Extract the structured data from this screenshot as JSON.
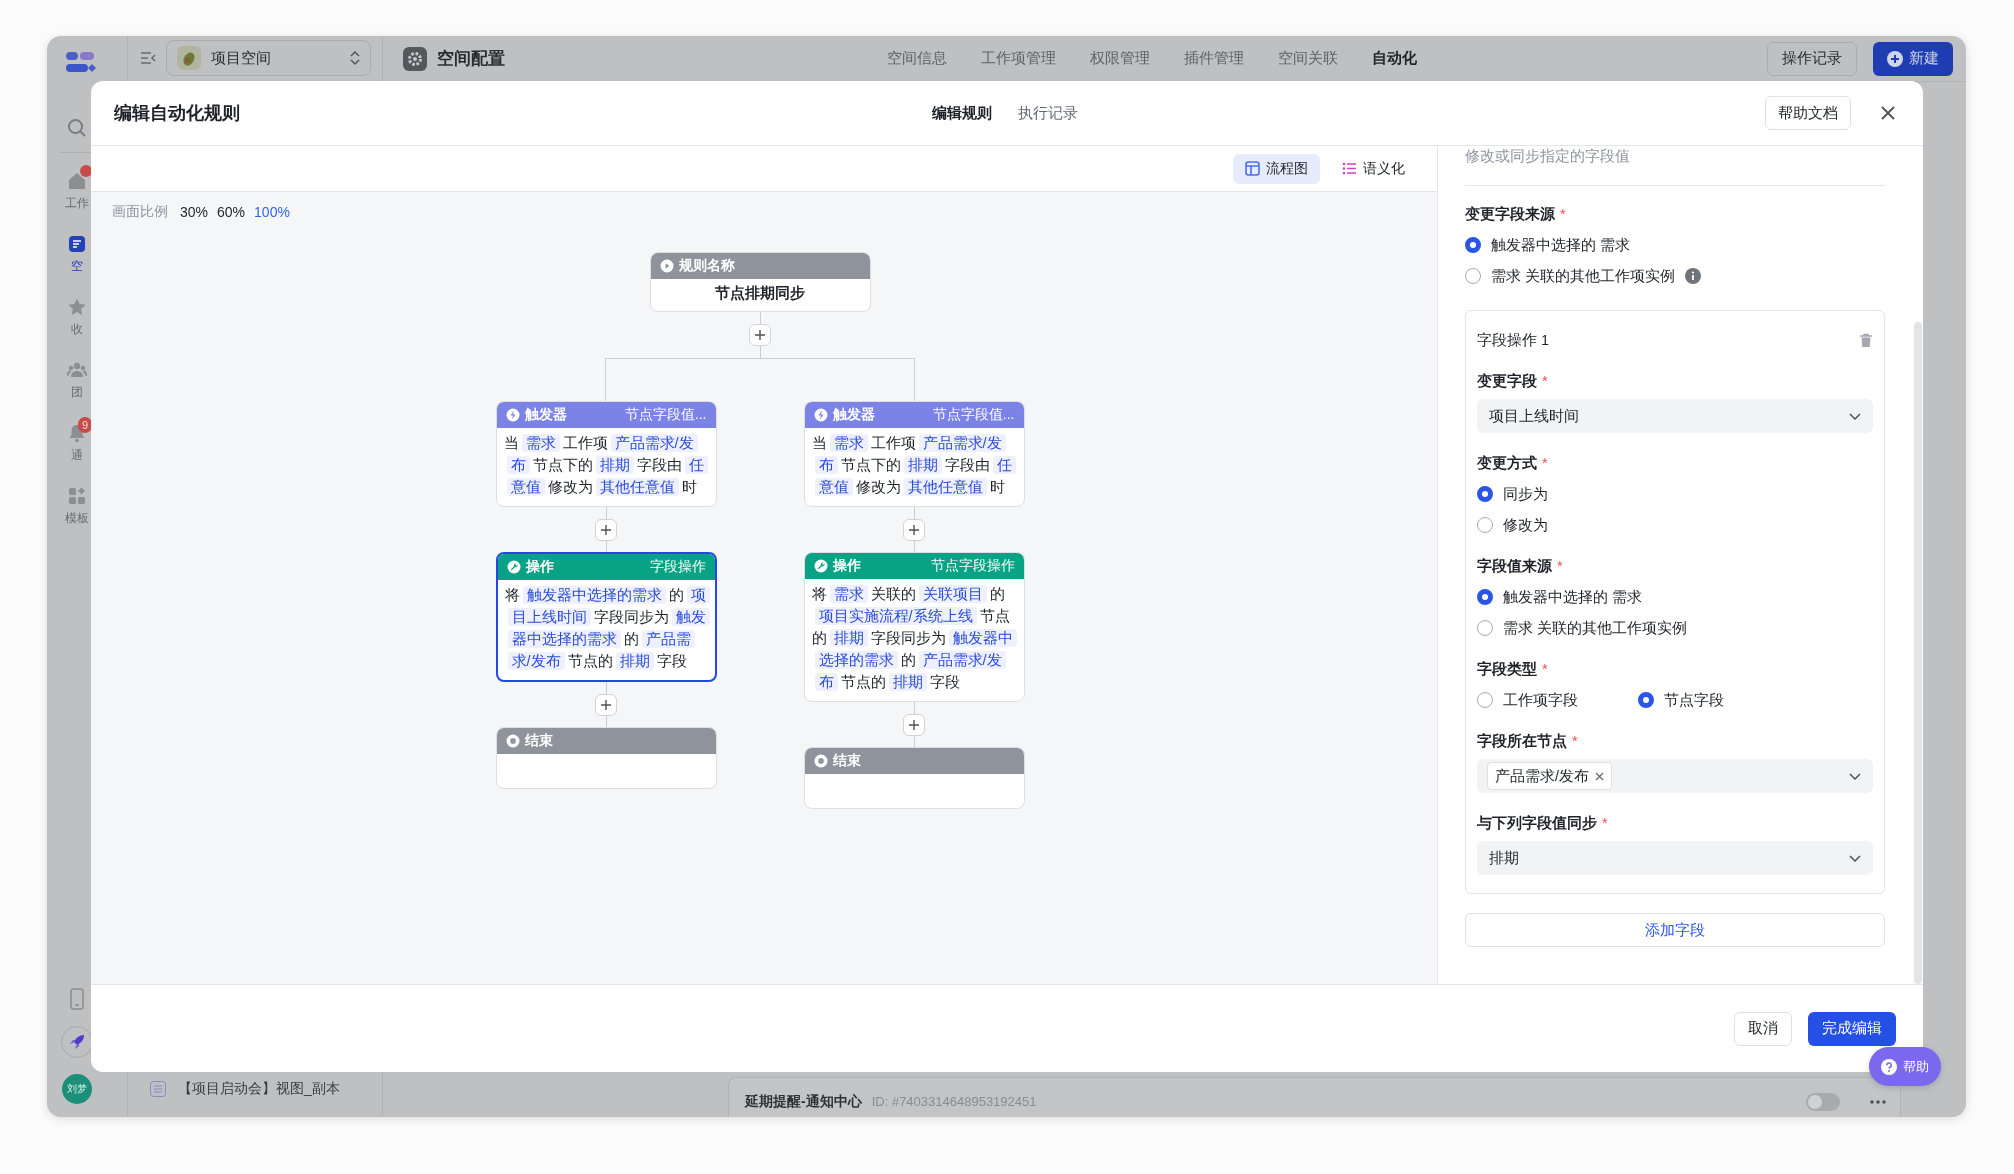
{
  "app": {
    "sidebar": {
      "items": [
        {
          "label": "工作",
          "kind": "home",
          "selected": false,
          "dot": true
        },
        {
          "label": "空",
          "kind": "space",
          "selected": true
        },
        {
          "label": "收",
          "kind": "star",
          "selected": false
        },
        {
          "label": "团",
          "kind": "team",
          "selected": false
        },
        {
          "label": "通",
          "kind": "bell",
          "selected": false,
          "badge": "9"
        },
        {
          "label": "模板",
          "kind": "grid",
          "selected": false
        }
      ],
      "avatar": "刘梦"
    },
    "project_select": "项目空间",
    "view_item": "【项目启动会】视图_副本",
    "header": {
      "title": "空间配置",
      "nav": [
        {
          "label": "空间信息",
          "selected": false
        },
        {
          "label": "工作项管理",
          "selected": false
        },
        {
          "label": "权限管理",
          "selected": false
        },
        {
          "label": "插件管理",
          "selected": false
        },
        {
          "label": "空间关联",
          "selected": false
        },
        {
          "label": "自动化",
          "selected": true
        }
      ],
      "log_button": "操作记录",
      "new_button": "新建"
    },
    "rule_card": {
      "title": "延期提醒-通知中心",
      "id": "ID: #7403314648953192451",
      "on": false
    }
  },
  "modal": {
    "title": "编辑自动化规则",
    "tabs": [
      {
        "label": "编辑规则",
        "selected": true
      },
      {
        "label": "执行记录",
        "selected": false
      }
    ],
    "help_button": "帮助文档",
    "view_toggle": [
      {
        "label": "流程图",
        "kind": "flow",
        "selected": true
      },
      {
        "label": "语义化",
        "kind": "list",
        "selected": false
      }
    ],
    "zoom": {
      "label": "画面比例",
      "options": [
        {
          "label": "30%",
          "selected": false
        },
        {
          "label": "60%",
          "selected": false
        },
        {
          "label": "100%",
          "selected": true
        }
      ]
    },
    "flow": {
      "root": {
        "kind": "rule",
        "title": "规则名称",
        "text": "节点排期同步"
      },
      "branches": [
        {
          "nodes": [
            {
              "kind": "trigger",
              "title": "触发器",
              "subtitle": "节点字段值...",
              "selected": false,
              "segments": [
                {
                  "kind": "text",
                  "text": "当"
                },
                {
                  "kind": "token",
                  "text": "需求"
                },
                {
                  "kind": "text",
                  "text": "工作项"
                },
                {
                  "kind": "token",
                  "text": "产品需求/发布"
                },
                {
                  "kind": "text",
                  "text": "节点下的"
                },
                {
                  "kind": "token",
                  "text": "排期"
                },
                {
                  "kind": "text",
                  "text": "字段由"
                },
                {
                  "kind": "token",
                  "text": "任意值"
                },
                {
                  "kind": "text",
                  "text": "修改为"
                },
                {
                  "kind": "token",
                  "text": "其他任意值"
                },
                {
                  "kind": "text",
                  "text": "时"
                }
              ]
            },
            {
              "kind": "action",
              "title": "操作",
              "subtitle": "字段操作",
              "selected": true,
              "segments": [
                {
                  "kind": "text",
                  "text": "将"
                },
                {
                  "kind": "token",
                  "text": "触发器中选择的需求"
                },
                {
                  "kind": "text",
                  "text": "的"
                },
                {
                  "kind": "token",
                  "text": "项目上线时间"
                },
                {
                  "kind": "text",
                  "text": "字段同步为"
                },
                {
                  "kind": "token",
                  "text": "触发器中选择的需求"
                },
                {
                  "kind": "text",
                  "text": "的"
                },
                {
                  "kind": "token",
                  "text": "产品需求/发布"
                },
                {
                  "kind": "text",
                  "text": "节点的"
                },
                {
                  "kind": "token",
                  "text": "排期"
                },
                {
                  "kind": "text",
                  "text": "字段"
                }
              ]
            },
            {
              "kind": "end",
              "title": "结束"
            }
          ]
        },
        {
          "nodes": [
            {
              "kind": "trigger",
              "title": "触发器",
              "subtitle": "节点字段值...",
              "selected": false,
              "segments": [
                {
                  "kind": "text",
                  "text": "当"
                },
                {
                  "kind": "token",
                  "text": "需求"
                },
                {
                  "kind": "text",
                  "text": "工作项"
                },
                {
                  "kind": "token",
                  "text": "产品需求/发布"
                },
                {
                  "kind": "text",
                  "text": "节点下的"
                },
                {
                  "kind": "token",
                  "text": "排期"
                },
                {
                  "kind": "text",
                  "text": "字段由"
                },
                {
                  "kind": "token",
                  "text": "任意值"
                },
                {
                  "kind": "text",
                  "text": "修改为"
                },
                {
                  "kind": "token",
                  "text": "其他任意值"
                },
                {
                  "kind": "text",
                  "text": "时"
                }
              ]
            },
            {
              "kind": "action",
              "title": "操作",
              "subtitle": "节点字段操作",
              "selected": false,
              "segments": [
                {
                  "kind": "text",
                  "text": "将"
                },
                {
                  "kind": "token",
                  "text": "需求"
                },
                {
                  "kind": "text",
                  "text": "关联的"
                },
                {
                  "kind": "token",
                  "text": "关联项目"
                },
                {
                  "kind": "text",
                  "text": "的"
                },
                {
                  "kind": "token",
                  "text": "项目实施流程/系统上线"
                },
                {
                  "kind": "text",
                  "text": "节点的"
                },
                {
                  "kind": "token",
                  "text": "排期"
                },
                {
                  "kind": "text",
                  "text": "字段同步为"
                },
                {
                  "kind": "token",
                  "text": "触发器中选择的需求"
                },
                {
                  "kind": "text",
                  "text": "的"
                },
                {
                  "kind": "token",
                  "text": "产品需求/发布"
                },
                {
                  "kind": "text",
                  "text": "节点的"
                },
                {
                  "kind": "token",
                  "text": "排期"
                },
                {
                  "kind": "text",
                  "text": "字段"
                }
              ]
            },
            {
              "kind": "end",
              "title": "结束"
            }
          ]
        }
      ]
    },
    "panel": {
      "description": "修改或同步指定的字段值",
      "source": {
        "label": "变更字段来源",
        "required_mark": "*",
        "options": [
          {
            "label": "触发器中选择的 需求",
            "selected": true
          },
          {
            "label": "需求 关联的其他工作项实例",
            "selected": false,
            "info": true
          }
        ]
      },
      "card": {
        "title": "字段操作 1",
        "fields": [
          {
            "kind": "select",
            "label": "变更字段",
            "required_mark": "*",
            "value": "项目上线时间"
          },
          {
            "kind": "radio",
            "label": "变更方式",
            "required_mark": "*",
            "inline": false,
            "options": [
              {
                "label": "同步为",
                "selected": true
              },
              {
                "label": "修改为",
                "selected": false
              }
            ]
          },
          {
            "kind": "radio",
            "label": "字段值来源",
            "required_mark": "*",
            "inline": false,
            "options": [
              {
                "label": "触发器中选择的 需求",
                "selected": true
              },
              {
                "label": "需求 关联的其他工作项实例",
                "selected": false
              }
            ]
          },
          {
            "kind": "radio",
            "label": "字段类型",
            "required_mark": "*",
            "inline": true,
            "options": [
              {
                "label": "工作项字段",
                "selected": false
              },
              {
                "label": "节点字段",
                "selected": true
              }
            ]
          },
          {
            "kind": "tags",
            "label": "字段所在节点",
            "required_mark": "*",
            "tags": [
              "产品需求/发布"
            ]
          },
          {
            "kind": "select",
            "label": "与下列字段值同步",
            "required_mark": "*",
            "value": "排期"
          }
        ]
      },
      "add_button": "添加字段"
    },
    "footer": {
      "cancel": "取消",
      "confirm": "完成编辑"
    }
  },
  "help_fab": "帮助"
}
